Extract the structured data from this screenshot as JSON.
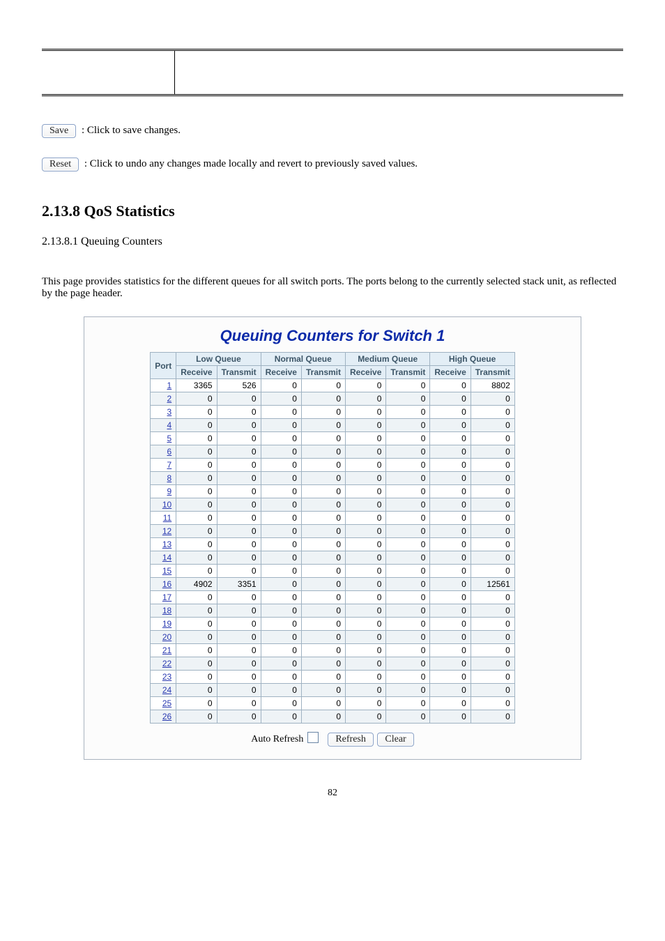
{
  "top_table": {
    "label": "",
    "description": ""
  },
  "buttons": {
    "save": {
      "label": "Save",
      "desc": ": Click to save changes."
    },
    "reset": {
      "label": "Reset",
      "desc": ": Click to undo any changes made locally and revert to previously saved values."
    }
  },
  "heading3": "2.13.8 QoS Statistics",
  "heading4": "2.13.8.1 Queuing Counters",
  "paragraph": "This page provides statistics for the different queues for all switch ports. The ports belong to the currently selected stack unit, as reflected by the page header.",
  "panel_title": "Queuing Counters for Switch 1",
  "table": {
    "port_header": "Port",
    "groups": [
      "Low Queue",
      "Normal Queue",
      "Medium Queue",
      "High Queue"
    ],
    "sub_headers": [
      "Receive",
      "Transmit"
    ],
    "rows": [
      {
        "port": "1",
        "low_rx": 3365,
        "low_tx": 526,
        "norm_rx": 0,
        "norm_tx": 0,
        "med_rx": 0,
        "med_tx": 0,
        "high_rx": 0,
        "high_tx": 8802
      },
      {
        "port": "2",
        "low_rx": 0,
        "low_tx": 0,
        "norm_rx": 0,
        "norm_tx": 0,
        "med_rx": 0,
        "med_tx": 0,
        "high_rx": 0,
        "high_tx": 0
      },
      {
        "port": "3",
        "low_rx": 0,
        "low_tx": 0,
        "norm_rx": 0,
        "norm_tx": 0,
        "med_rx": 0,
        "med_tx": 0,
        "high_rx": 0,
        "high_tx": 0
      },
      {
        "port": "4",
        "low_rx": 0,
        "low_tx": 0,
        "norm_rx": 0,
        "norm_tx": 0,
        "med_rx": 0,
        "med_tx": 0,
        "high_rx": 0,
        "high_tx": 0
      },
      {
        "port": "5",
        "low_rx": 0,
        "low_tx": 0,
        "norm_rx": 0,
        "norm_tx": 0,
        "med_rx": 0,
        "med_tx": 0,
        "high_rx": 0,
        "high_tx": 0
      },
      {
        "port": "6",
        "low_rx": 0,
        "low_tx": 0,
        "norm_rx": 0,
        "norm_tx": 0,
        "med_rx": 0,
        "med_tx": 0,
        "high_rx": 0,
        "high_tx": 0
      },
      {
        "port": "7",
        "low_rx": 0,
        "low_tx": 0,
        "norm_rx": 0,
        "norm_tx": 0,
        "med_rx": 0,
        "med_tx": 0,
        "high_rx": 0,
        "high_tx": 0
      },
      {
        "port": "8",
        "low_rx": 0,
        "low_tx": 0,
        "norm_rx": 0,
        "norm_tx": 0,
        "med_rx": 0,
        "med_tx": 0,
        "high_rx": 0,
        "high_tx": 0
      },
      {
        "port": "9",
        "low_rx": 0,
        "low_tx": 0,
        "norm_rx": 0,
        "norm_tx": 0,
        "med_rx": 0,
        "med_tx": 0,
        "high_rx": 0,
        "high_tx": 0
      },
      {
        "port": "10",
        "low_rx": 0,
        "low_tx": 0,
        "norm_rx": 0,
        "norm_tx": 0,
        "med_rx": 0,
        "med_tx": 0,
        "high_rx": 0,
        "high_tx": 0
      },
      {
        "port": "11",
        "low_rx": 0,
        "low_tx": 0,
        "norm_rx": 0,
        "norm_tx": 0,
        "med_rx": 0,
        "med_tx": 0,
        "high_rx": 0,
        "high_tx": 0
      },
      {
        "port": "12",
        "low_rx": 0,
        "low_tx": 0,
        "norm_rx": 0,
        "norm_tx": 0,
        "med_rx": 0,
        "med_tx": 0,
        "high_rx": 0,
        "high_tx": 0
      },
      {
        "port": "13",
        "low_rx": 0,
        "low_tx": 0,
        "norm_rx": 0,
        "norm_tx": 0,
        "med_rx": 0,
        "med_tx": 0,
        "high_rx": 0,
        "high_tx": 0
      },
      {
        "port": "14",
        "low_rx": 0,
        "low_tx": 0,
        "norm_rx": 0,
        "norm_tx": 0,
        "med_rx": 0,
        "med_tx": 0,
        "high_rx": 0,
        "high_tx": 0
      },
      {
        "port": "15",
        "low_rx": 0,
        "low_tx": 0,
        "norm_rx": 0,
        "norm_tx": 0,
        "med_rx": 0,
        "med_tx": 0,
        "high_rx": 0,
        "high_tx": 0
      },
      {
        "port": "16",
        "low_rx": 4902,
        "low_tx": 3351,
        "norm_rx": 0,
        "norm_tx": 0,
        "med_rx": 0,
        "med_tx": 0,
        "high_rx": 0,
        "high_tx": 12561
      },
      {
        "port": "17",
        "low_rx": 0,
        "low_tx": 0,
        "norm_rx": 0,
        "norm_tx": 0,
        "med_rx": 0,
        "med_tx": 0,
        "high_rx": 0,
        "high_tx": 0
      },
      {
        "port": "18",
        "low_rx": 0,
        "low_tx": 0,
        "norm_rx": 0,
        "norm_tx": 0,
        "med_rx": 0,
        "med_tx": 0,
        "high_rx": 0,
        "high_tx": 0
      },
      {
        "port": "19",
        "low_rx": 0,
        "low_tx": 0,
        "norm_rx": 0,
        "norm_tx": 0,
        "med_rx": 0,
        "med_tx": 0,
        "high_rx": 0,
        "high_tx": 0
      },
      {
        "port": "20",
        "low_rx": 0,
        "low_tx": 0,
        "norm_rx": 0,
        "norm_tx": 0,
        "med_rx": 0,
        "med_tx": 0,
        "high_rx": 0,
        "high_tx": 0
      },
      {
        "port": "21",
        "low_rx": 0,
        "low_tx": 0,
        "norm_rx": 0,
        "norm_tx": 0,
        "med_rx": 0,
        "med_tx": 0,
        "high_rx": 0,
        "high_tx": 0
      },
      {
        "port": "22",
        "low_rx": 0,
        "low_tx": 0,
        "norm_rx": 0,
        "norm_tx": 0,
        "med_rx": 0,
        "med_tx": 0,
        "high_rx": 0,
        "high_tx": 0
      },
      {
        "port": "23",
        "low_rx": 0,
        "low_tx": 0,
        "norm_rx": 0,
        "norm_tx": 0,
        "med_rx": 0,
        "med_tx": 0,
        "high_rx": 0,
        "high_tx": 0
      },
      {
        "port": "24",
        "low_rx": 0,
        "low_tx": 0,
        "norm_rx": 0,
        "norm_tx": 0,
        "med_rx": 0,
        "med_tx": 0,
        "high_rx": 0,
        "high_tx": 0
      },
      {
        "port": "25",
        "low_rx": 0,
        "low_tx": 0,
        "norm_rx": 0,
        "norm_tx": 0,
        "med_rx": 0,
        "med_tx": 0,
        "high_rx": 0,
        "high_tx": 0
      },
      {
        "port": "26",
        "low_rx": 0,
        "low_tx": 0,
        "norm_rx": 0,
        "norm_tx": 0,
        "med_rx": 0,
        "med_tx": 0,
        "high_rx": 0,
        "high_tx": 0
      }
    ]
  },
  "controls": {
    "auto_refresh_label": "Auto Refresh",
    "refresh_label": "Refresh",
    "clear_label": "Clear"
  },
  "pageno": "82"
}
